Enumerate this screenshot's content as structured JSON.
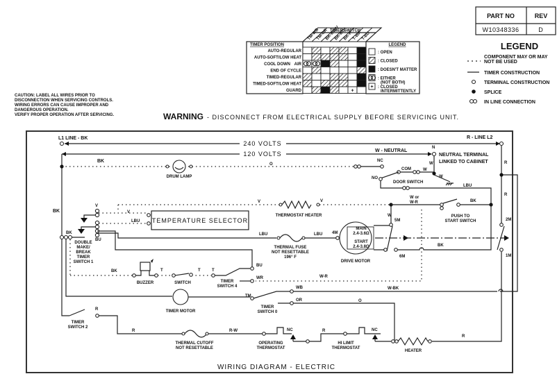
{
  "part_table": {
    "part_no_header": "PART NO",
    "rev_header": "REV",
    "part_no": "W10348336",
    "rev": "D"
  },
  "legend": {
    "title": "LEGEND",
    "items": [
      {
        "symbol": "dashed-line",
        "line1": "COMPONENT MAY OR MAY",
        "line2": "NOT BE USED"
      },
      {
        "symbol": "solid-line",
        "line1": "TIMER CONSTRUCTION"
      },
      {
        "symbol": "open-circle",
        "line1": "TERMINAL CONSTRUCTION"
      },
      {
        "symbol": "filled-dot",
        "line1": "SPLICE"
      },
      {
        "symbol": "double-circle",
        "line1": "IN LINE CONNECTION"
      }
    ]
  },
  "timer_chart": {
    "title": "TIMER SWITCH",
    "position_header": "TIMER POSITION",
    "columns": [
      "TM-WB",
      "TM-OR",
      "BK-BU-V",
      "BK-BU",
      "BK-R",
      "T-WR",
      "T-BU"
    ],
    "rows": [
      {
        "label": "AUTO-REGULAR",
        "states": [
          "open",
          "closed",
          "open",
          "closed",
          "closed",
          "open",
          "dont_care"
        ]
      },
      {
        "label": "AUTO-SOFT/LOW HEAT",
        "states": [
          "open",
          "closed",
          "closed",
          "closed",
          "closed",
          "open",
          "dont_care"
        ]
      },
      {
        "label": "COOL DOWN",
        "extra": "AIR",
        "states": [
          "either",
          "either",
          "dont_care",
          "closed",
          "open",
          "open",
          "dont_care"
        ]
      },
      {
        "label": "END OF CYCLE",
        "states": [
          "open",
          "closed",
          "open",
          "open",
          "open",
          "open",
          "closed"
        ]
      },
      {
        "label": "TIMED-REGULAR",
        "states": [
          "closed",
          "open",
          "open",
          "closed",
          "closed",
          "open",
          "dont_care"
        ]
      },
      {
        "label": "TIMED-SOFT/LOW HEAT",
        "states": [
          "closed",
          "open",
          "closed",
          "closed",
          "closed",
          "open",
          "dont_care"
        ]
      },
      {
        "label": "GUARD",
        "states": [
          "open",
          "closed",
          "dont_care",
          "closed",
          "open",
          "intermittent",
          "open"
        ]
      }
    ],
    "legend_title": "LEGEND",
    "legend": [
      {
        "state": "open",
        "line1": ": OPEN"
      },
      {
        "state": "closed",
        "line1": ": CLOSED"
      },
      {
        "state": "dont_care",
        "line1": ": DOESN'T MATTER"
      },
      {
        "state": "either",
        "line1": ": EITHER",
        "line2": "(NOT BOTH)"
      },
      {
        "state": "intermittent",
        "line1": ": CLOSED",
        "line2": "INTERMITTENTLY"
      }
    ]
  },
  "caution": [
    "CAUTION: LABEL ALL WIRES PRIOR TO",
    "DISCONNECTION WHEN SERVICING CONTROLS.",
    "WIRING ERRORS CAN CAUSE IMPROPER AND",
    "DANGEROUS OPERATION.",
    "VERIFY PROPER OPERATION AFTER SERVICING."
  ],
  "warning": {
    "bold": "WARNING",
    "text": "- DISCONNECT FROM ELECTRICAL SUPPLY BEFORE SERVICING UNIT."
  },
  "diagram": {
    "title": "WIRING DIAGRAM - ELECTRIC",
    "l1": "L1 LINE - BK",
    "l2": "R - LINE L2",
    "v240": "240 VOLTS",
    "v120": "120 VOLTS",
    "neutral": "W - NEUTRAL",
    "n": "N",
    "neutral_terminal_1": "NEUTRAL TERMINAL",
    "neutral_terminal_2": "LINKED TO CABINET",
    "bk": "BK",
    "o": "O",
    "nc": "NC",
    "com": "COM",
    "no": "NO",
    "w": "W",
    "r": "R",
    "lbu": "LBU",
    "v": "V",
    "bu": "BU",
    "t": "T",
    "wr": "WR",
    "w_r": "W-R",
    "w_or_wr_1": "W or",
    "w_or_wr_2": "W-R",
    "wb": "WB",
    "or": "OR",
    "w_bk": "W-BK",
    "tm": "TM",
    "r_w": "R-W",
    "drum_lamp": "DRUM LAMP",
    "door_switch": "DOOR SWITCH",
    "thermostat_heater": "THERMOSTAT HEATER",
    "temperature_selector": "TEMPERATURE SELECTOR",
    "push_to_start_1": "PUSH TO",
    "push_to_start_2": "START SWITCH",
    "thermal_fuse_1": "THERMAL FUSE",
    "thermal_fuse_2": "NOT RESETTABLE",
    "thermal_fuse_3": "196° F",
    "motor_main": "MAIN",
    "motor_main_ohm": "2.4-3.6Ω",
    "motor_start": "START",
    "motor_start_ohm": "2.4-3.8Ω",
    "drive_motor": "DRIVE MOTOR",
    "m4": "4M",
    "m5": "5M",
    "m6": "6M",
    "m2": "2M",
    "m1": "1M",
    "dmb_1": "DOUBLE",
    "dmb_2": "MAKE/",
    "dmb_3": "BREAK",
    "dmb_4": "TIMER",
    "dmb_5": "SWITCH 1",
    "buzzer": "BUZZER",
    "switch": "SWITCH",
    "ts4_1": "TIMER",
    "ts4_2": "SWITCH 4",
    "timer_motor": "TIMER MOTOR",
    "ts0_1": "TIMER",
    "ts0_2": "SWITCH 0",
    "ts2_1": "TIMER",
    "ts2_2": "SWITCH 2",
    "thermal_cutoff_1": "THERMAL CUTOFF",
    "thermal_cutoff_2": "NOT RESETTABLE",
    "op_thermo_1": "OPERATING",
    "op_thermo_2": "THERMOSTAT",
    "hi_limit_1": "HI LIMIT",
    "hi_limit_2": "THERMOSTAT",
    "heater": "HEATER"
  }
}
